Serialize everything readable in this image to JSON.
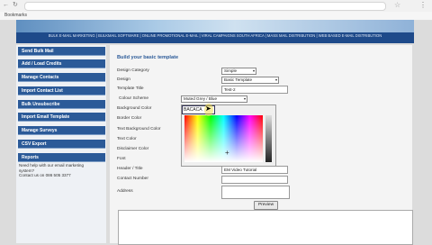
{
  "browser": {
    "bookmarks_label": "Bookmarks"
  },
  "header_links": "BULK E-MAIL MARKETING | BULKMAIL SOFTWARE | ONLINE PROMOTIONAL E-MAIL | VIRAL CAMPAIGNS SOUTH AFRICA | MASS MAIL DISTRIBUTION | WEB BASED E-MAIL DISTRIBUTION",
  "sidebar": {
    "items": [
      {
        "label": "Send Bulk Mail"
      },
      {
        "label": "Add / Load Credits"
      },
      {
        "label": "Manage Contacts"
      },
      {
        "label": "Import Contact List"
      },
      {
        "label": "Bulk Unsubscribe"
      },
      {
        "label": "Import Email Template"
      },
      {
        "label": "Manage Surveys"
      },
      {
        "label": "CSV Export"
      },
      {
        "label": "Reports"
      }
    ],
    "help_text": "Need help with our email marketing system?",
    "contact_text": "Contact us on 086 505 3377"
  },
  "form": {
    "title": "Build your basic template",
    "design_category_label": "Design Category",
    "design_category_value": "Simple",
    "design_label": "Design",
    "design_value": "Basic Template",
    "template_title_label": "Template Title",
    "template_title_value": "Test-2",
    "colour_scheme_label": "Colour Scheme",
    "colour_scheme_value": "Muted Grey / Blue",
    "background_color_label": "Background Color",
    "background_color_value": "BACACA",
    "border_color_label": "Border Color",
    "text_background_color_label": "Text Background Color",
    "text_color_label": "Text Color",
    "disclaimer_color_label": "Disclaimer Color",
    "font_label": "Font",
    "header_title_label": "Header / Title",
    "header_title_value": "EM Video Tutorial",
    "contact_number_label": "Contact Number",
    "address_label": "Address",
    "preview_button": "Preview"
  }
}
